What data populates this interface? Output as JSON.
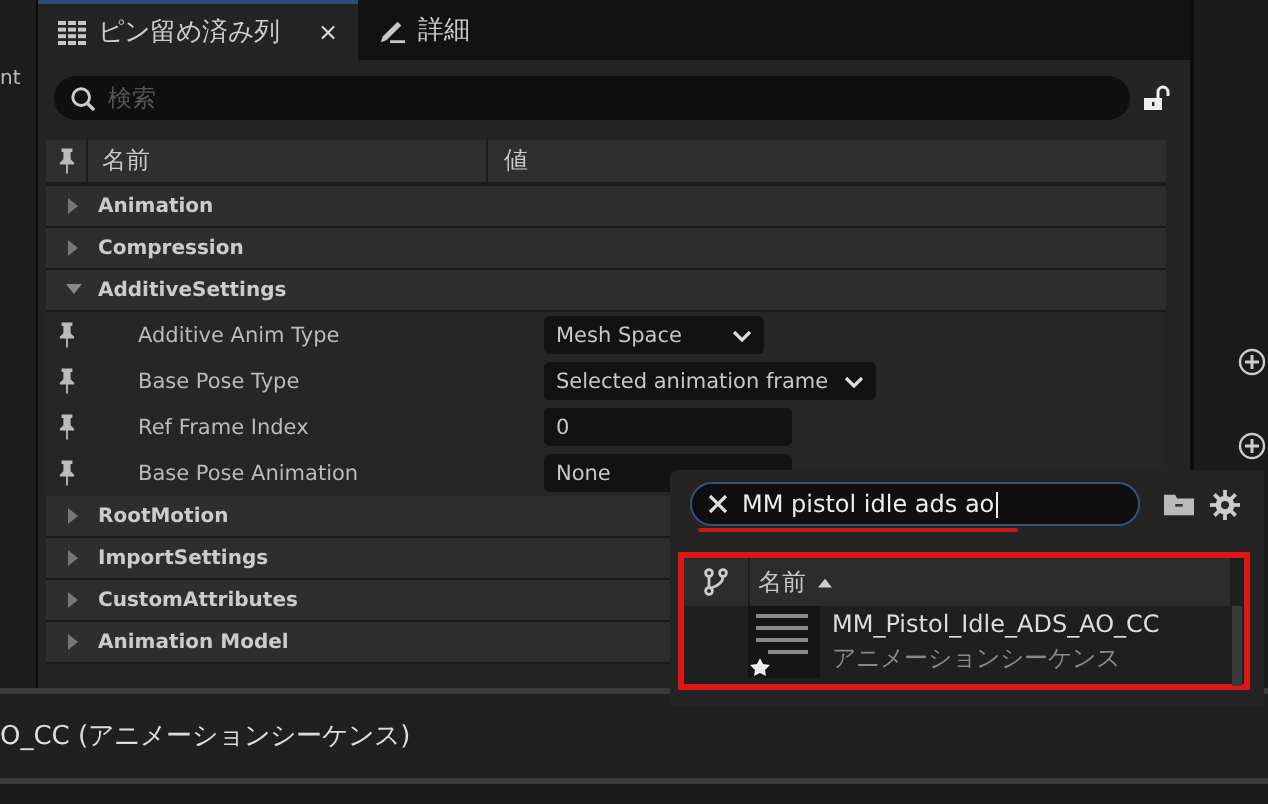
{
  "left_panel": {
    "text": "nt"
  },
  "tabs": [
    {
      "label": "ピン留め済み列",
      "selected": true,
      "close": "×"
    },
    {
      "label": "詳細",
      "selected": false
    }
  ],
  "search": {
    "placeholder": "検索",
    "locked": false
  },
  "columns": [
    "名前",
    "値"
  ],
  "rows": [
    {
      "kind": "category",
      "label": "Animation",
      "expanded": false
    },
    {
      "kind": "category",
      "label": "Compression",
      "expanded": false
    },
    {
      "kind": "category",
      "label": "AdditiveSettings",
      "expanded": true
    },
    {
      "kind": "dropdown",
      "label": "Additive Anim Type",
      "value": "Mesh Space"
    },
    {
      "kind": "dropdown",
      "label": "Base Pose Type",
      "value": "Selected animation frame"
    },
    {
      "kind": "number",
      "label": "Ref Frame Index",
      "value": "0"
    },
    {
      "kind": "asset",
      "label": "Base Pose Animation",
      "value": "None"
    },
    {
      "kind": "category",
      "label": "RootMotion",
      "expanded": false
    },
    {
      "kind": "category",
      "label": "ImportSettings",
      "expanded": false
    },
    {
      "kind": "category",
      "label": "CustomAttributes",
      "expanded": false
    },
    {
      "kind": "category",
      "label": "Animation Model",
      "expanded": false
    }
  ],
  "asset_picker": {
    "search_value": "MM pistol idle ads ao",
    "column": "名前",
    "assets": [
      {
        "name": "MM_Pistol_Idle_ADS_AO_CC",
        "type": "アニメーションシーケンス",
        "selected": false
      }
    ]
  },
  "bottom_panel": {
    "title": "O_CC (アニメーションシーケンス)"
  }
}
